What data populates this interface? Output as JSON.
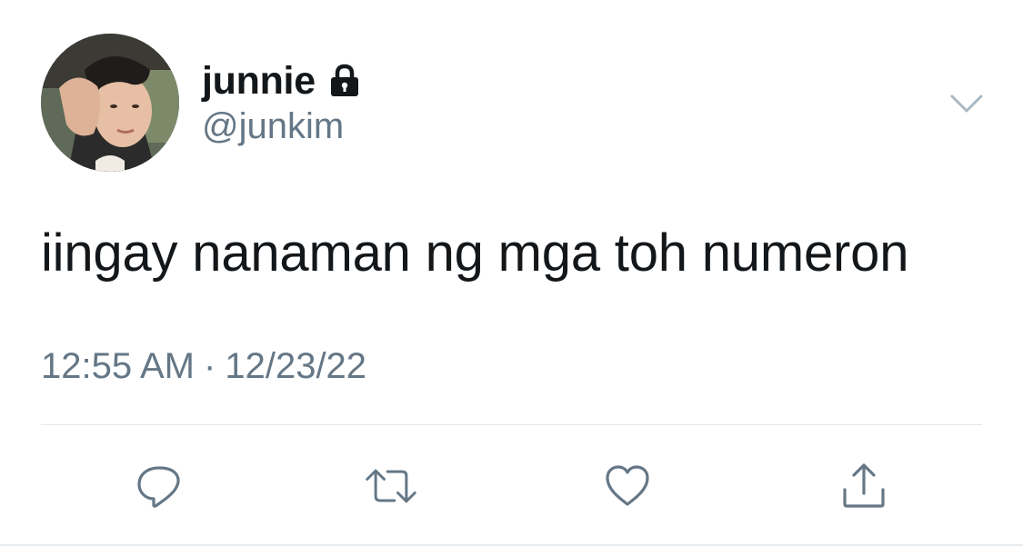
{
  "tweet": {
    "author": {
      "display_name": "junnie",
      "handle": "@junkim",
      "avatar_icon": "profile-photo",
      "protected_icon": "lock-icon"
    },
    "text": "iingay nanaman ng mga toh numeron",
    "time": "12:55 AM",
    "separator": "·",
    "date": "12/23/22"
  },
  "actions": [
    {
      "name": "reply",
      "icon": "reply-icon"
    },
    {
      "name": "retweet",
      "icon": "retweet-icon"
    },
    {
      "name": "like",
      "icon": "heart-icon"
    },
    {
      "name": "share",
      "icon": "share-icon"
    }
  ],
  "colors": {
    "primary_text": "#14171a",
    "secondary_text": "#657786",
    "divider": "#e1e8ed"
  }
}
